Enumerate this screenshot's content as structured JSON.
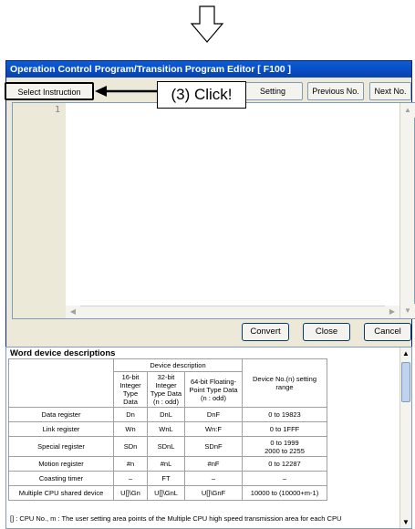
{
  "window": {
    "title": "Operation Control Program/Transition Program Editor [ F100 ]"
  },
  "toolbar": {
    "select_instruction": "Select Instruction",
    "setting_label": "Setting",
    "prev_label": "Previous No.",
    "next_label": "Next No."
  },
  "callout": {
    "text": "(3) Click!"
  },
  "editor": {
    "line_number": "1"
  },
  "buttons": {
    "convert": "Convert",
    "close": "Close",
    "cancel": "Cancel"
  },
  "descriptions": {
    "title": "Word device descriptions",
    "group_header": "Device description",
    "col_16": "16-bit Integer Type Data",
    "col_32": "32-bit Integer Type Data (n : odd)",
    "col_64": "64-bit Floating-Point Type Data (n : odd)",
    "col_range": "Device No.(n) setting range",
    "rows": [
      {
        "name": "Data register",
        "d16": "Dn",
        "d32": "DnL",
        "d64": "DnF",
        "range": "0 to 19823"
      },
      {
        "name": "Link register",
        "d16": "Wn",
        "d32": "WnL",
        "d64": "Wn:F",
        "range": "0 to 1FFF"
      },
      {
        "name": "Special register",
        "d16": "SDn",
        "d32": "SDnL",
        "d64": "SDnF",
        "range": "0 to 1999\n2000 to 2255"
      },
      {
        "name": "Motion register",
        "d16": "#n",
        "d32": "#nL",
        "d64": "#nF",
        "range": "0 to 12287"
      },
      {
        "name": "Coasting timer",
        "d16": "–",
        "d32": "FT",
        "d64": "–",
        "range": "–"
      },
      {
        "name": "Multiple CPU shared device",
        "d16": "U[]\\Gn",
        "d32": "U[]\\GnL",
        "d64": "U[]\\GnF",
        "range": "10000 to (10000+m-1)"
      }
    ],
    "note": "[] : CPU No., m : The user setting area points of the Multiple CPU high speed transmission area for each CPU"
  }
}
